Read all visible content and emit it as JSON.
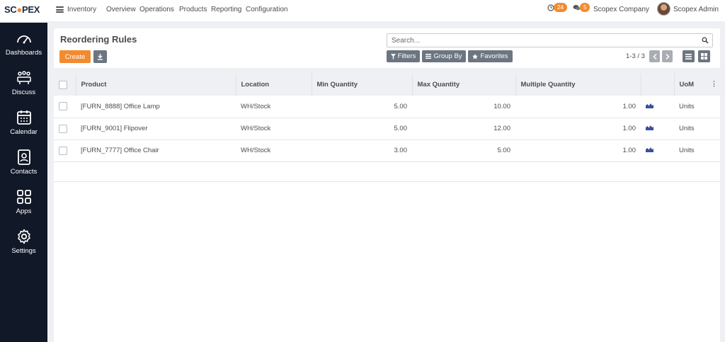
{
  "app": {
    "logo_text_1": "SC",
    "logo_text_2": "PEX",
    "current_app": "Inventory",
    "menu": [
      "Overview",
      "Operations",
      "Products",
      "Reporting",
      "Configuration"
    ],
    "activity_count": "24",
    "message_count": "5",
    "company": "Scopex Company",
    "user": "Scopex Admin"
  },
  "sidebar": {
    "items": [
      {
        "label": "Dashboards",
        "icon": "gauge-icon"
      },
      {
        "label": "Discuss",
        "icon": "discuss-icon"
      },
      {
        "label": "Calendar",
        "icon": "calendar-icon"
      },
      {
        "label": "Contacts",
        "icon": "contacts-icon"
      },
      {
        "label": "Apps",
        "icon": "apps-grid-icon"
      },
      {
        "label": "Settings",
        "icon": "gear-icon"
      }
    ]
  },
  "control": {
    "title": "Reordering Rules",
    "create_label": "Create",
    "search_placeholder": "Search...",
    "filters_label": "Filters",
    "groupby_label": "Group By",
    "favorites_label": "Favorites",
    "pager": "1-3 / 3"
  },
  "table": {
    "columns": {
      "product": "Product",
      "location": "Location",
      "min_qty": "Min Quantity",
      "max_qty": "Max Quantity",
      "multiple_qty": "Multiple Quantity",
      "uom": "UoM"
    },
    "rows": [
      {
        "product": "[FURN_8888] Office Lamp",
        "location": "WH/Stock",
        "min_qty": "5.00",
        "max_qty": "10.00",
        "multiple_qty": "1.00",
        "uom": "Units"
      },
      {
        "product": "[FURN_9001] Flipover",
        "location": "WH/Stock",
        "min_qty": "5.00",
        "max_qty": "12.00",
        "multiple_qty": "1.00",
        "uom": "Units"
      },
      {
        "product": "[FURN_7777] Office Chair",
        "location": "WH/Stock",
        "min_qty": "3.00",
        "max_qty": "5.00",
        "multiple_qty": "1.00",
        "uom": "Units"
      }
    ]
  },
  "colors": {
    "accent": "#f28b30",
    "sidebar": "#111827",
    "button_grey": "#6c7580"
  }
}
